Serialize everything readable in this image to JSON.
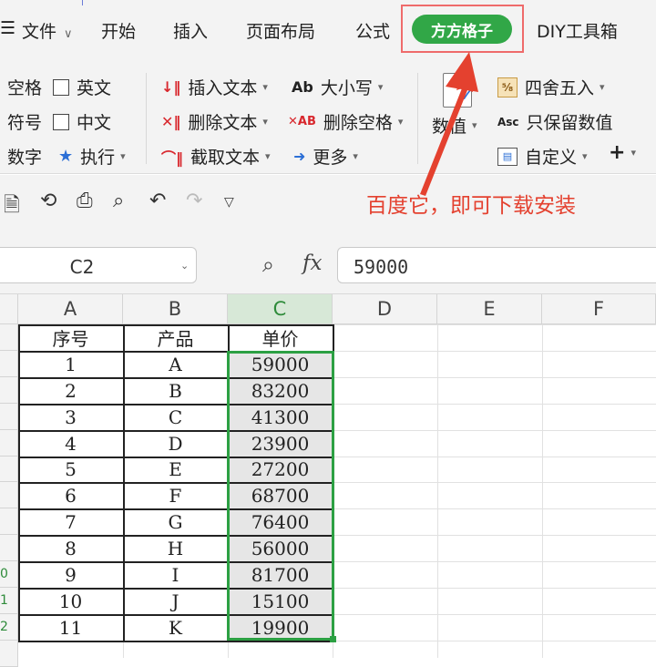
{
  "tabs": [
    {
      "label": "文件"
    },
    {
      "label": "开始"
    },
    {
      "label": "插入"
    },
    {
      "label": "页面布局"
    },
    {
      "label": "公式"
    },
    {
      "label": "方方格子"
    },
    {
      "label": "DIY工具箱"
    }
  ],
  "ribbon": {
    "col1": [
      "空格",
      "符号",
      "数字"
    ],
    "col2": [
      "英文",
      "中文",
      "执行"
    ],
    "col3": [
      "插入文本",
      "删除文本",
      "截取文本"
    ],
    "col4": [
      "大小写",
      "删除空格",
      "更多"
    ],
    "col4_icons": [
      "Ab",
      "✕AB",
      "➜"
    ],
    "numeric_label": "数值",
    "col6": [
      "四舍五入",
      "只保留数值",
      "自定义"
    ],
    "col6_icon2": "Asc",
    "plus": "+"
  },
  "annotation": "百度它，即可下载安装",
  "name_box": "C2",
  "fx": "fx",
  "formula": "59000",
  "columns": [
    "A",
    "B",
    "C",
    "D",
    "E",
    "F"
  ],
  "rows": [
    {
      "hdr": "",
      "a": "序号",
      "b": "产品",
      "c": "单价"
    },
    {
      "hdr": "",
      "a": "1",
      "b": "A",
      "c": "59000"
    },
    {
      "hdr": "",
      "a": "2",
      "b": "B",
      "c": "83200"
    },
    {
      "hdr": "",
      "a": "3",
      "b": "C",
      "c": "41300"
    },
    {
      "hdr": "",
      "a": "4",
      "b": "D",
      "c": "23900"
    },
    {
      "hdr": "",
      "a": "5",
      "b": "E",
      "c": "27200"
    },
    {
      "hdr": "",
      "a": "6",
      "b": "F",
      "c": "68700"
    },
    {
      "hdr": "",
      "a": "7",
      "b": "G",
      "c": "76400"
    },
    {
      "hdr": "",
      "a": "8",
      "b": "H",
      "c": "56000"
    },
    {
      "hdr": "0",
      "a": "9",
      "b": "I",
      "c": "81700"
    },
    {
      "hdr": "1",
      "a": "10",
      "b": "J",
      "c": "15100"
    },
    {
      "hdr": "2",
      "a": "11",
      "b": "K",
      "c": "19900"
    }
  ],
  "colors": {
    "accent_green": "#31a747",
    "selection_green": "#2ca043",
    "annotation_red": "#e4412f"
  }
}
